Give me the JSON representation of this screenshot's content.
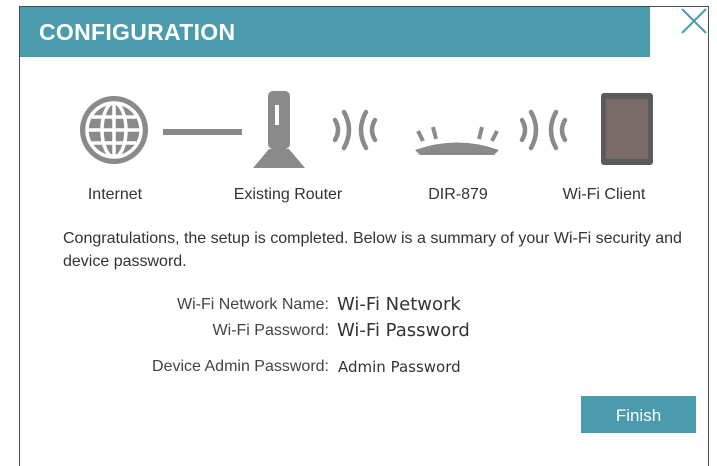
{
  "dialog": {
    "title": "CONFIGURATION",
    "close_icon": "close-icon"
  },
  "topology": {
    "nodes": [
      {
        "label": "Internet",
        "icon": "globe-icon"
      },
      {
        "label": "Existing Router",
        "icon": "router-icon"
      },
      {
        "label": "DIR-879",
        "icon": "extender-icon"
      },
      {
        "label": "Wi-Fi Client",
        "icon": "tablet-icon"
      }
    ],
    "links": [
      "wired-link-icon",
      "wireless-link-icon",
      "wireless-link-icon"
    ]
  },
  "summary": {
    "message": "Congratulations, the setup is completed. Below is a summary of your Wi-Fi security and device password.",
    "wifi_name_label": "Wi-Fi Network Name:",
    "wifi_name_value": "Wi-Fi Network",
    "wifi_password_label": "Wi-Fi Password:",
    "wifi_password_value": "Wi-Fi Password",
    "admin_password_label": "Device Admin Password:",
    "admin_password_value": "Admin Password"
  },
  "actions": {
    "finish_label": "Finish"
  },
  "colors": {
    "accent": "#4a9bab",
    "icon": "#8a8a8a",
    "text": "#333333"
  }
}
